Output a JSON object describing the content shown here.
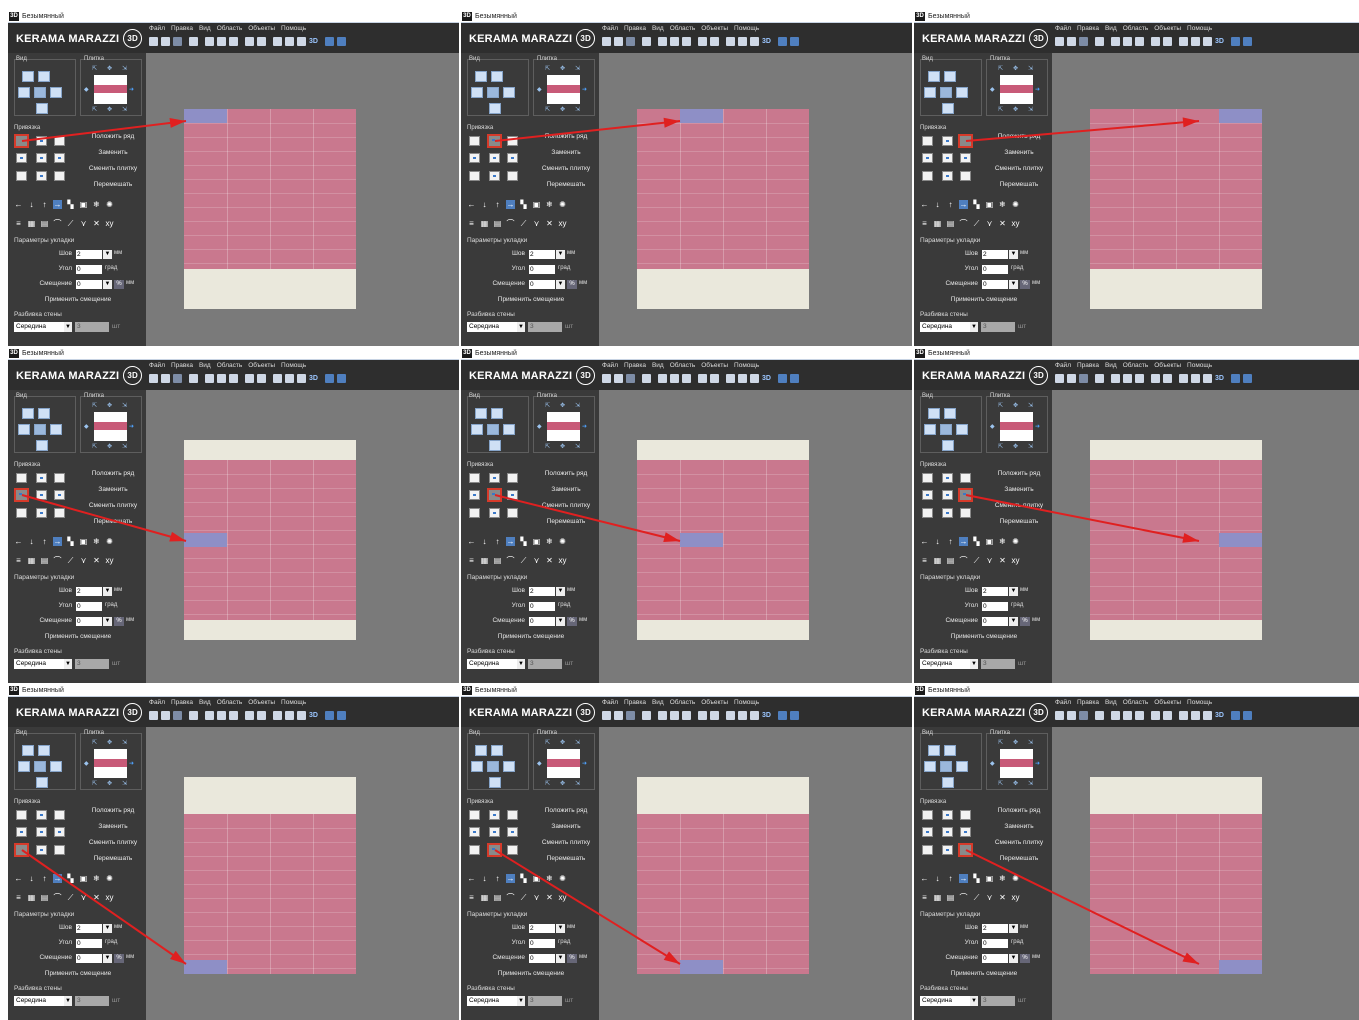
{
  "window": {
    "badge": "3D",
    "title": "Безымянный"
  },
  "brand": {
    "name": "KERAMA MARAZZI",
    "mark": "3D"
  },
  "menu": [
    "Файл",
    "Правка",
    "Вид",
    "Область",
    "Объекты",
    "Помощь"
  ],
  "toolbar": {
    "icons": [
      "new-icon",
      "open-icon",
      "save-icon",
      "print-icon",
      "cut-icon",
      "copy-icon",
      "paste-icon",
      "undo-icon",
      "redo-icon",
      "export-icon",
      "render-icon",
      "calc-icon"
    ],
    "label_3d": "3D"
  },
  "panel": {
    "view_label": "Вид",
    "tile_label": "Плитка",
    "snap_label": "Привязка",
    "actions": [
      "Положить ряд",
      "Заменить",
      "Сменить плитку",
      "Перемешать"
    ],
    "tool_row1": [
      "←",
      "↓",
      "↑",
      "→",
      "▚",
      "▣",
      "❄",
      "✺"
    ],
    "tool_row2": [
      "≡",
      "▦",
      "▤",
      "⌒",
      "⟋",
      "⋎",
      "✕",
      "xy"
    ],
    "params_label": "Параметры укладки",
    "seam": {
      "label": "Шов",
      "value": "2",
      "unit": "мм"
    },
    "angle": {
      "label": "Угол",
      "value": "0",
      "unit": "град"
    },
    "offset": {
      "label": "Смещение",
      "value": "0",
      "pct": "%",
      "unit": "мм"
    },
    "apply_offset": "Применить смещение",
    "wall_split_label": "Разбивка стены",
    "wall_split_value": "Середина",
    "wall_split_count": "3",
    "wall_split_unit": "шт"
  },
  "colors": {
    "pink": "#c9788e",
    "cream": "#eae8dc",
    "highlight": "#8e8fc6",
    "arrow": "#e02020",
    "snap_border": "#d53a2a"
  },
  "panels": [
    {
      "snap": "top-left",
      "tile": "top-left"
    },
    {
      "snap": "top-center",
      "tile": "top-center"
    },
    {
      "snap": "top-right",
      "tile": "top-right"
    },
    {
      "snap": "middle-left",
      "tile": "middle-left"
    },
    {
      "snap": "middle-center",
      "tile": "middle-center"
    },
    {
      "snap": "middle-right",
      "tile": "middle-right"
    },
    {
      "snap": "bottom-left",
      "tile": "bottom-left"
    },
    {
      "snap": "bottom-center",
      "tile": "bottom-center"
    },
    {
      "snap": "bottom-right",
      "tile": "bottom-right"
    }
  ]
}
